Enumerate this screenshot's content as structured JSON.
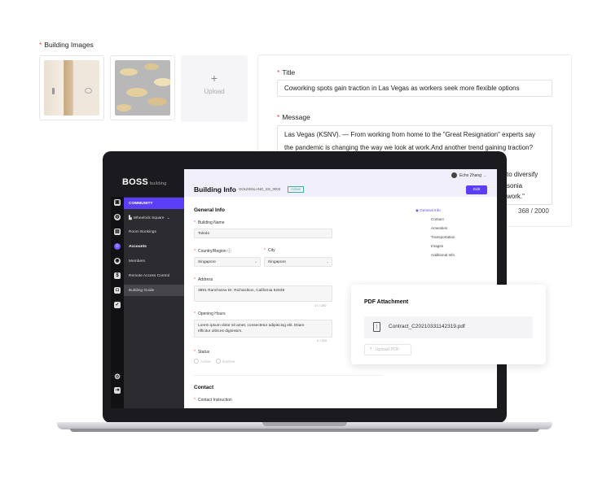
{
  "building_images": {
    "label": "Building Images",
    "upload_label": "Upload",
    "plus": "+"
  },
  "message_form": {
    "title_label": "Title",
    "title_value": "Coworking spots gain traction in Las Vegas as workers seek more flexible options",
    "message_label": "Message",
    "message_lines": [
      "Las Vegas (KSNV). — From working from home to the \"Great Resignation\" experts say",
      "the pandemic is changing the way we look at work.And another trend gaining traction?",
      "",
      "to diversify",
      "sonia",
      "work.\""
    ],
    "counter": "368 / 2000"
  },
  "app": {
    "logo": "BOSS",
    "logo_sub": "building",
    "user_name": "Echo Zhang",
    "page_title": "Building Info",
    "building_code": "GOLDENLAND_SG_0003",
    "status_badge": "Active",
    "edit_label": "Edit",
    "sidebar": [
      {
        "label": "COMMUNITY"
      },
      {
        "label": "Wheelock Square"
      },
      {
        "label": "Room Bookings"
      },
      {
        "label": "Accounts"
      },
      {
        "label": "Members"
      },
      {
        "label": "Remote Access Control"
      },
      {
        "label": "Building Guide"
      }
    ],
    "general_info": {
      "heading": "General Info",
      "building_name_label": "Building Name",
      "building_name_value": "Toledo",
      "country_label": "Country/Region",
      "country_value": "Singapore",
      "city_label": "City",
      "city_value": "Singapore",
      "address_label": "Address",
      "address_value": "3891 Ranchview Dr. Richardson, California 62639",
      "address_counter": "17 / 200",
      "hours_label": "Opening Hours",
      "hours_value_1": "Lorem ipsum dolor sit amet, consectetur adipiscing elit. Etiam",
      "hours_value_2": "efficitur ultrices dignissim.",
      "hours_counter": "0 / 110",
      "status_label": "Status",
      "status_active": "Active",
      "status_inactive": "Inactive"
    },
    "contact": {
      "heading": "Contact",
      "instruction_label": "Contact Instruction"
    },
    "toc": [
      "General Info",
      "Contact",
      "Amenities",
      "Transportation",
      "Images",
      "Additional Info"
    ]
  },
  "pdf": {
    "title": "PDF Attachment",
    "file_name": "Contract_C20210331142319.pdf",
    "upload_label": "Upload PDF"
  },
  "colors": {
    "accent": "#5b3ff8",
    "required": "#e5484d",
    "sidebar_bg": "#2b2b30"
  }
}
